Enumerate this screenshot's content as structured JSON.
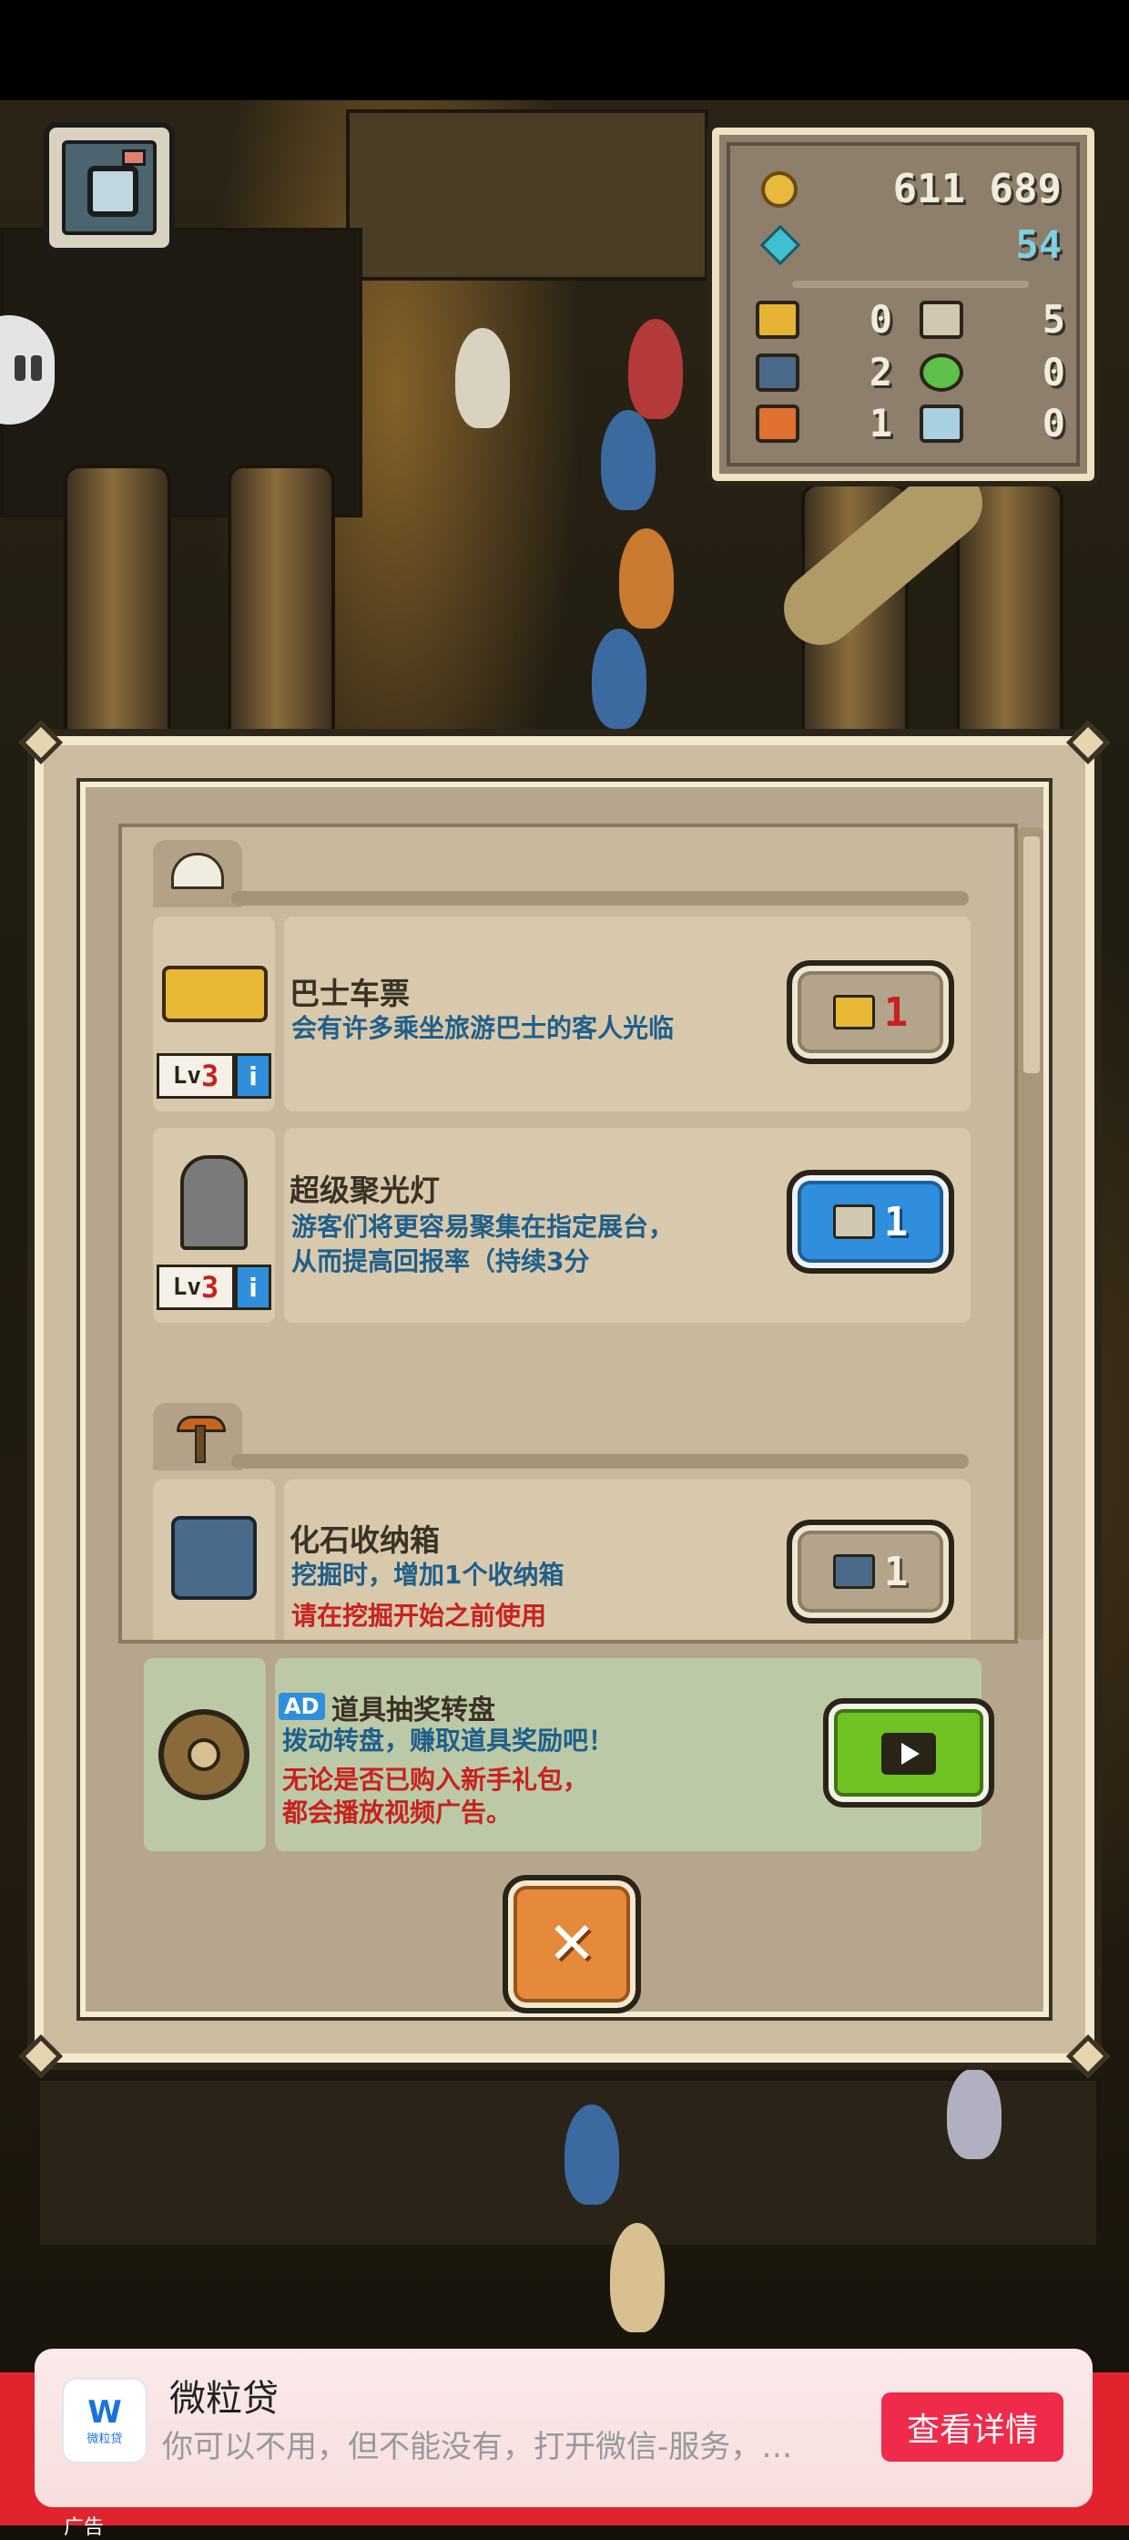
{
  "resources": {
    "coins": "611 689",
    "gems": "54",
    "bus_tickets": "0",
    "spotlights": "5",
    "boxes": "2",
    "potions": "0",
    "bags": "1",
    "cards": "0"
  },
  "items": [
    {
      "title": "巴士车票",
      "desc_lines": [
        "会有许多乘坐旅游巴士的客人光临"
      ],
      "level_prefix": "Lv",
      "level": "3",
      "count": "1",
      "button_style": "gray"
    },
    {
      "title": "超级聚光灯",
      "desc_lines": [
        "游客们将更容易聚集在指定展台，",
        "从而提高回报率（持续3分"
      ],
      "level_prefix": "Lv",
      "level": "3",
      "count": "1",
      "button_style": "blue"
    },
    {
      "title": "化石收纳箱",
      "desc_lines": [
        "挖掘时，增加1个收纳箱"
      ],
      "warning": "请在挖掘开始之前使用",
      "count": "1",
      "button_style": "gray"
    }
  ],
  "info_icon_label": "i",
  "ad_roulette": {
    "badge": "AD",
    "title": "道具抽奖转盘",
    "line1": "拨动转盘，赚取道具奖励吧！",
    "line2": "无论是否已购入新手礼包，",
    "line3": "都会播放视频广告。"
  },
  "close_label": "✕",
  "banner_ad": {
    "app_icon_text": "W",
    "app_icon_caption": "微粒贷",
    "app_name": "微粒贷",
    "description": "你可以不用，但不能没有，打开微信-服务，…",
    "cta": "查看详情",
    "footer": "广告"
  },
  "colors": {
    "panel": "#cbbca0",
    "desc_text": "#1f5f8a",
    "warning_text": "#c8221e",
    "blue_button": "#2f8fdc",
    "close_button": "#e58a3a",
    "video_button": "#6fc221",
    "ad_cta": "#ef2a4a"
  }
}
